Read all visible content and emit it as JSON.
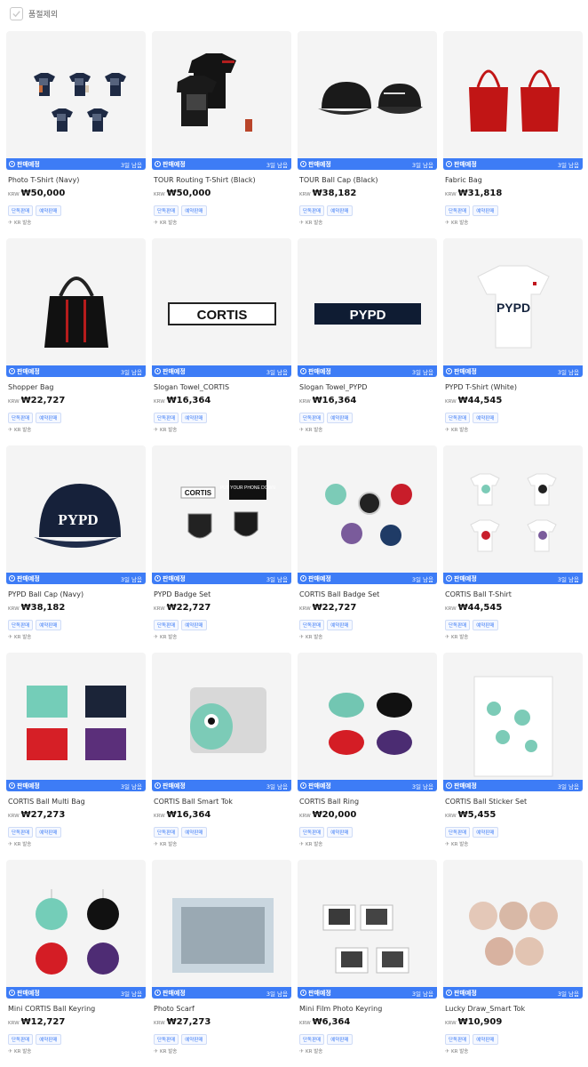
{
  "filter": {
    "label": "품절제외",
    "checked": false
  },
  "product_common": {
    "status_label": "판매예정",
    "days_label": "3일 남음",
    "currency": "KRW",
    "tag1": "단독판매",
    "tag2": "예약판매",
    "ship_label": "KR 발송"
  },
  "products": [
    {
      "name": "Photo T-Shirt (Navy)",
      "price": "₩50,000",
      "image_icon": "tshirt-navy-icon"
    },
    {
      "name": "TOUR Routing T-Shirt (Black)",
      "price": "₩50,000",
      "image_icon": "tshirt-black-icon"
    },
    {
      "name": "TOUR Ball Cap (Black)",
      "price": "₩38,182",
      "image_icon": "cap-black-icon"
    },
    {
      "name": "Fabric Bag",
      "price": "₩31,818",
      "image_icon": "bag-red-icon"
    },
    {
      "name": "Shopper Bag",
      "price": "₩22,727",
      "image_icon": "bag-black-icon"
    },
    {
      "name": "Slogan Towel_CORTIS",
      "price": "₩16,364",
      "image_icon": "towel-cortis-icon",
      "image_text": "CORTIS"
    },
    {
      "name": "Slogan Towel_PYPD",
      "price": "₩16,364",
      "image_icon": "towel-pypd-icon",
      "image_text": "PYPD"
    },
    {
      "name": "PYPD T-Shirt (White)",
      "price": "₩44,545",
      "image_icon": "tshirt-white-icon",
      "image_text": "PYPD"
    },
    {
      "name": "PYPD Ball Cap (Navy)",
      "price": "₩38,182",
      "image_icon": "cap-navy-icon",
      "image_text": "PYPD"
    },
    {
      "name": "PYPD Badge Set",
      "price": "₩22,727",
      "image_icon": "badge-set-icon",
      "image_text": "CORTIS",
      "image_text2": "PUT YOUR PHONE DOWN"
    },
    {
      "name": "CORTIS Ball Badge Set",
      "price": "₩22,727",
      "image_icon": "ball-badges-icon"
    },
    {
      "name": "CORTIS Ball T-Shirt",
      "price": "₩44,545",
      "image_icon": "ball-tshirts-icon"
    },
    {
      "name": "CORTIS Ball Multi Bag",
      "price": "₩27,273",
      "image_icon": "multi-bags-icon"
    },
    {
      "name": "CORTIS Ball Smart Tok",
      "price": "₩16,364",
      "image_icon": "smart-tok-icon"
    },
    {
      "name": "CORTIS Ball Ring",
      "price": "₩20,000",
      "image_icon": "ball-rings-icon"
    },
    {
      "name": "CORTIS Ball Sticker Set",
      "price": "₩5,455",
      "image_icon": "sticker-sheet-icon"
    },
    {
      "name": "Mini CORTIS Ball Keyring",
      "price": "₩12,727",
      "image_icon": "keyrings-icon"
    },
    {
      "name": "Photo Scarf",
      "price": "₩27,273",
      "image_icon": "photo-scarf-icon"
    },
    {
      "name": "Mini Film Photo Keyring",
      "price": "₩6,364",
      "image_icon": "film-keyring-icon"
    },
    {
      "name": "Lucky Draw_Smart Tok",
      "price": "₩10,909",
      "image_icon": "lucky-draw-icon"
    }
  ],
  "colors": {
    "accent": "#3d7cf6",
    "thumb_bg": "#f4f4f4"
  }
}
